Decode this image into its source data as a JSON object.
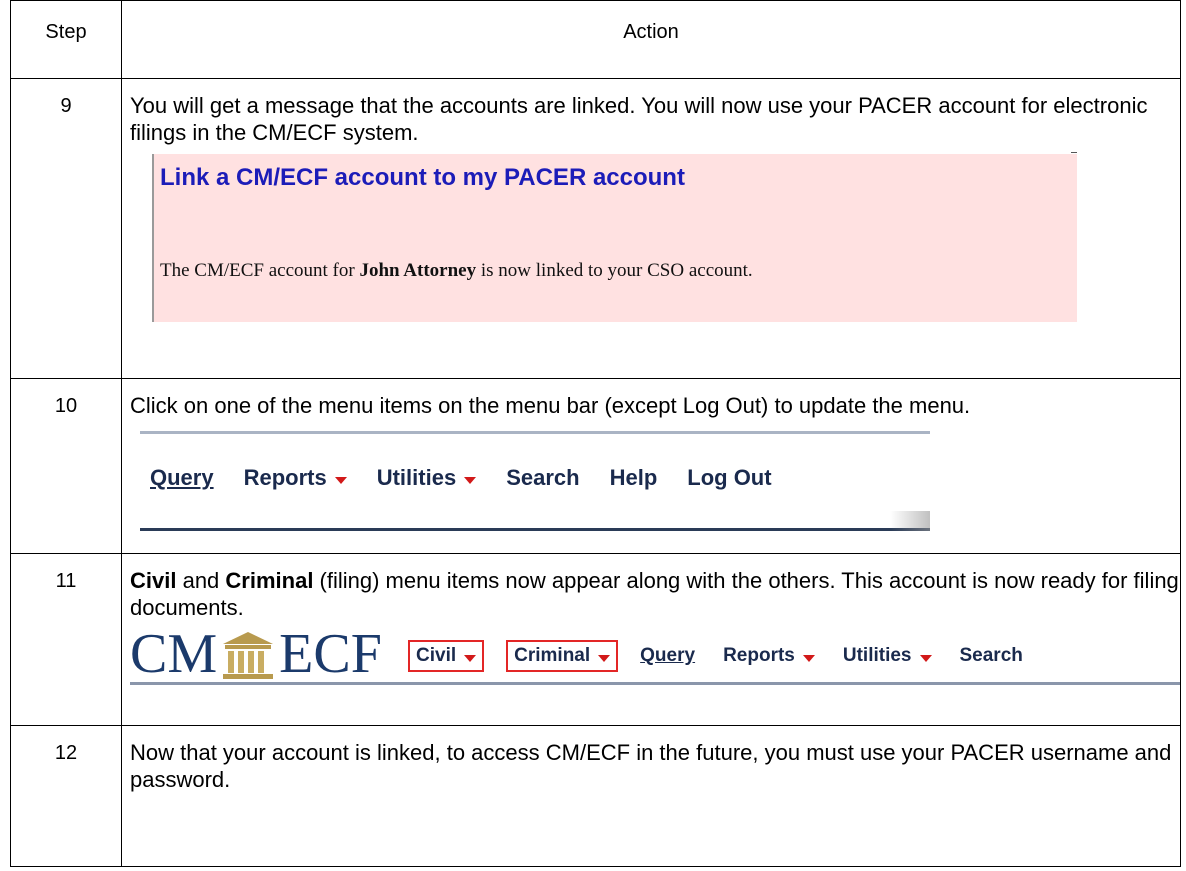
{
  "header": {
    "step": "Step",
    "action": "Action"
  },
  "rows": [
    {
      "step": "9",
      "text": "You will get a message that the accounts are linked.  You will now use your PACER account for electronic filings in the CM/ECF system.",
      "panel": {
        "title": "Link a CM/ECF account to my PACER account",
        "msg_before": "The CM/ECF account for ",
        "msg_name": "John Attorney",
        "msg_after": " is now linked to your CSO account."
      }
    },
    {
      "step": "10",
      "text": "Click on one of the menu items on the menu bar (except Log Out) to update the menu.",
      "menu": [
        "Query",
        "Reports",
        "Utilities",
        "Search",
        "Help",
        "Log Out"
      ]
    },
    {
      "step": "11",
      "text_civil": "Civil",
      "text_and": " and ",
      "text_criminal": "Criminal",
      "text_rest": " (filing) menu items now appear along with the others. This account is now ready for filing documents.",
      "logo_left": "CM",
      "logo_right": "ECF",
      "menu": [
        "Civil",
        "Criminal",
        "Query",
        "Reports",
        "Utilities",
        "Search"
      ]
    },
    {
      "step": "12",
      "text": "Now that your account is linked, to access CM/ECF in the future, you must use your PACER username and password."
    }
  ],
  "colors": {
    "panel_bg": "#ffe1e1",
    "panel_title": "#1c1cb8",
    "menu_text": "#1a2a4d",
    "caret": "#d21919",
    "highlight_box": "#e32626"
  }
}
